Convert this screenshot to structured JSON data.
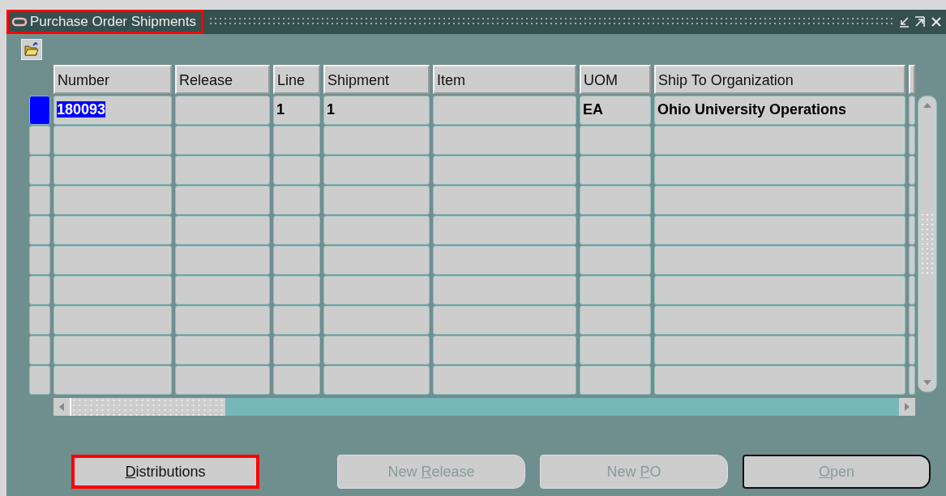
{
  "window": {
    "title": "Purchase Order Shipments",
    "title_highlighted": true
  },
  "table": {
    "columns": [
      "Number",
      "Release",
      "Line",
      "Shipment",
      "Item",
      "UOM",
      "Ship To Organization"
    ],
    "rows": [
      {
        "selected": true,
        "cells": [
          "180093",
          null,
          "1",
          "1",
          null,
          "EA",
          "Ohio University Operations"
        ]
      },
      {
        "selected": false
      },
      {
        "selected": false
      },
      {
        "selected": false
      },
      {
        "selected": false
      },
      {
        "selected": false
      },
      {
        "selected": false
      },
      {
        "selected": false
      },
      {
        "selected": false
      },
      {
        "selected": false
      }
    ]
  },
  "buttons": [
    {
      "key": "D",
      "after": "istributions",
      "disabled": false,
      "default": false,
      "highlighted": true
    },
    {
      "before": "New ",
      "key": "R",
      "after": "elease",
      "disabled": true,
      "default": false,
      "highlighted": false
    },
    {
      "before": "New ",
      "key": "P",
      "after": "O",
      "disabled": true,
      "default": false,
      "highlighted": false
    },
    {
      "key": "O",
      "after": "pen",
      "disabled": true,
      "default": true,
      "highlighted": false
    }
  ]
}
